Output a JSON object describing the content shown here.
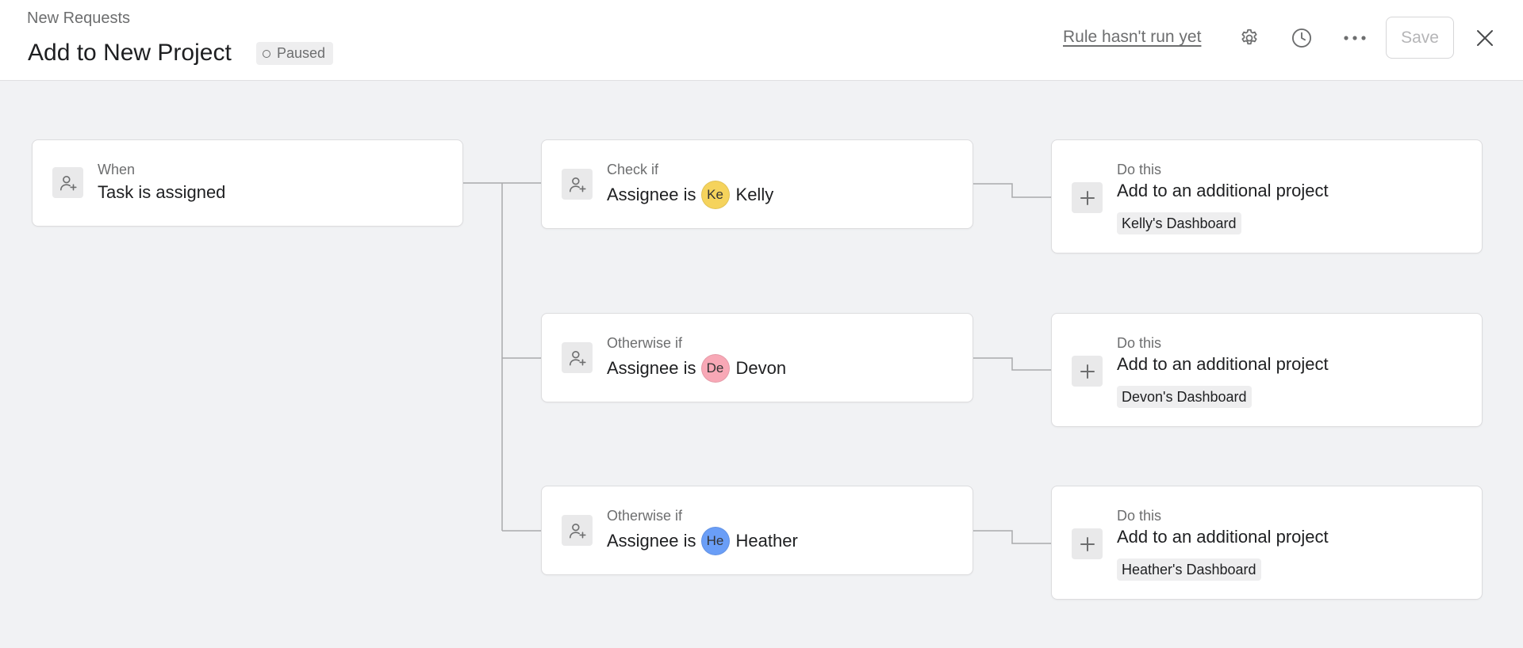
{
  "header": {
    "breadcrumb": "New Requests",
    "title": "Add to New Project",
    "status": "Paused",
    "run_status_link": "Rule hasn't run yet",
    "save_label": "Save",
    "icons": [
      "gear-icon",
      "clock-icon",
      "more-icon",
      "close-icon"
    ]
  },
  "trigger": {
    "label": "When",
    "text": "Task is assigned",
    "icon": "user-add-icon"
  },
  "conditions": [
    {
      "label": "Check if",
      "prefix": "Assignee is",
      "avatar_initials": "Ke",
      "avatar_color": "#f5d35c",
      "name": "Kelly",
      "action_label": "Do this",
      "action_text": "Add to an additional project",
      "project": "Kelly's Dashboard"
    },
    {
      "label": "Otherwise if",
      "prefix": "Assignee is",
      "avatar_initials": "De",
      "avatar_color": "#f8a8b6",
      "name": "Devon",
      "action_label": "Do this",
      "action_text": "Add to an additional project",
      "project": "Devon's Dashboard"
    },
    {
      "label": "Otherwise if",
      "prefix": "Assignee is",
      "avatar_initials": "He",
      "avatar_color": "#6a9ef7",
      "name": "Heather",
      "action_label": "Do this",
      "action_text": "Add to an additional project",
      "project": "Heather's Dashboard"
    }
  ]
}
